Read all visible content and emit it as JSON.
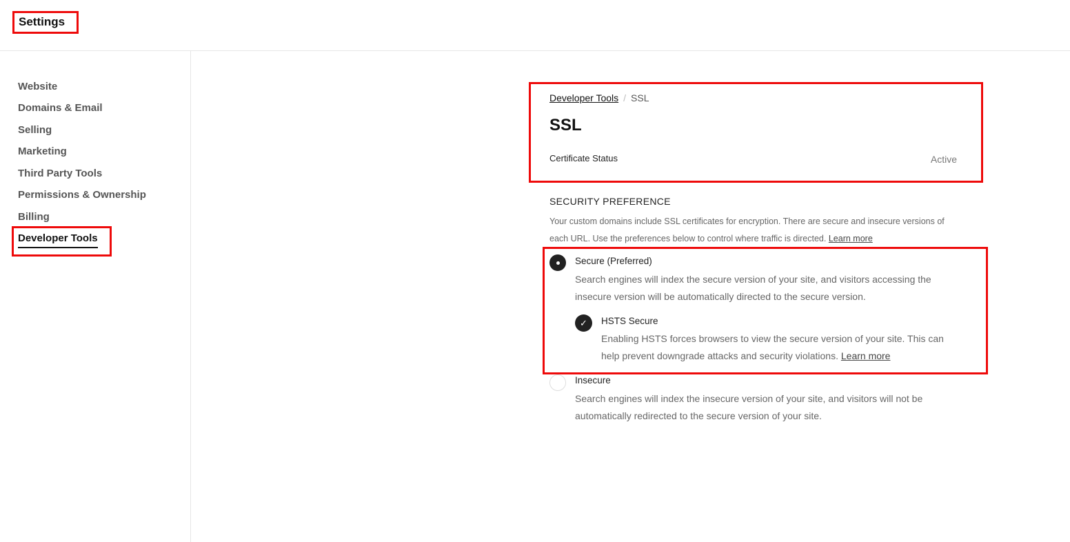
{
  "header": {
    "title": "Settings"
  },
  "sidebar": {
    "items": [
      {
        "label": "Website"
      },
      {
        "label": "Domains & Email"
      },
      {
        "label": "Selling"
      },
      {
        "label": "Marketing"
      },
      {
        "label": "Third Party Tools"
      },
      {
        "label": "Permissions & Ownership"
      },
      {
        "label": "Billing"
      },
      {
        "label": "Developer Tools",
        "active": true
      }
    ]
  },
  "main": {
    "breadcrumb": {
      "parent": "Developer Tools",
      "separator": "/",
      "current": "SSL"
    },
    "title": "SSL",
    "certificate": {
      "label": "Certificate Status",
      "value": "Active"
    },
    "security": {
      "heading": "SECURITY PREFERENCE",
      "description": "Your custom domains include SSL certificates for encryption. There are secure and insecure versions of each URL. Use the preferences below to control where traffic is directed.",
      "learn_more": "Learn more",
      "options": [
        {
          "label": "Secure (Preferred)",
          "description": "Search engines will index the secure version of your site, and visitors accessing the insecure version will be automatically directed to the secure version.",
          "selected": true
        },
        {
          "label": "Insecure",
          "description": "Search engines will index the insecure version of your site, and visitors will not be automatically redirected to the secure version of your site.",
          "selected": false
        }
      ],
      "hsts": {
        "label": "HSTS Secure",
        "description": "Enabling HSTS forces browsers to view the secure version of your site. This can help prevent downgrade attacks and security violations.",
        "learn_more": "Learn more",
        "checked": true
      }
    }
  },
  "colors": {
    "highlight": "#ee0a0a",
    "selected": "#222222"
  }
}
